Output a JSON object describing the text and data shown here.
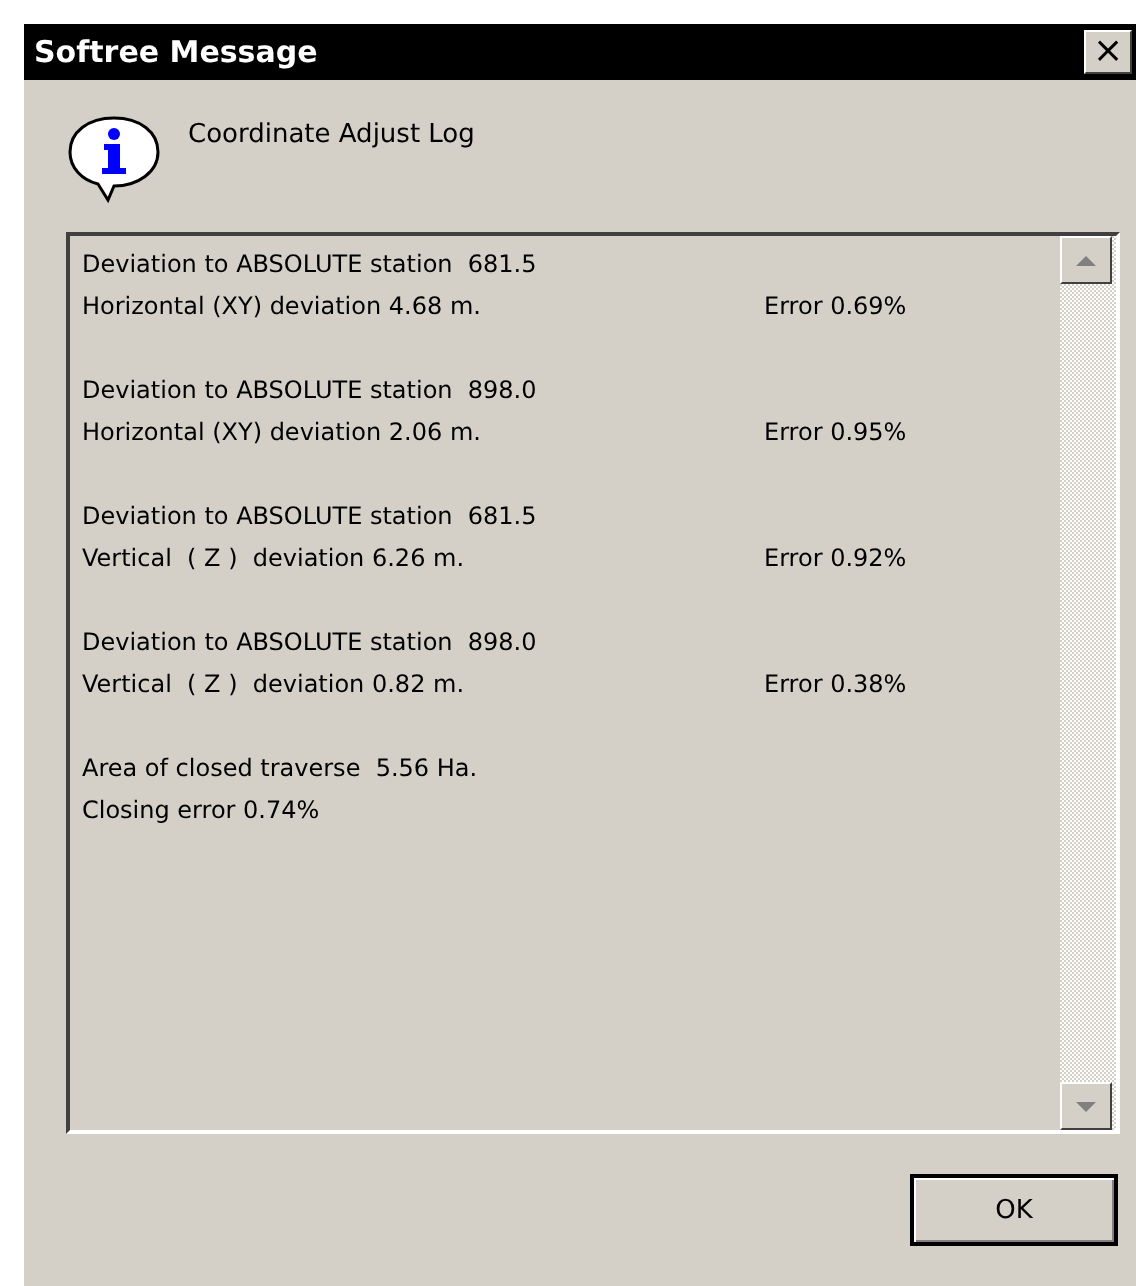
{
  "window": {
    "title": "Softree Message",
    "close": "×"
  },
  "heading": "Coordinate Adjust Log",
  "log": [
    {
      "line_1": "Deviation to ABSOLUTE station  681.5",
      "line_2": "Horizontal (XY) deviation 4.68 m.",
      "error": "Error 0.69%"
    },
    {
      "line_1": "Deviation to ABSOLUTE station  898.0",
      "line_2": "Horizontal (XY) deviation 2.06 m.",
      "error": "Error 0.95%"
    },
    {
      "line_1": "Deviation to ABSOLUTE station  681.5",
      "line_2": "Vertical  ( Z )  deviation 6.26 m.",
      "error": "Error 0.92%"
    },
    {
      "line_1": "Deviation to ABSOLUTE station  898.0",
      "line_2": "Vertical  ( Z )  deviation 0.82 m.",
      "error": "Error 0.38%"
    },
    {
      "line_1": "Area of closed traverse  5.56 Ha.",
      "line_2": "Closing error 0.74%"
    }
  ],
  "buttons": [
    "OK"
  ]
}
